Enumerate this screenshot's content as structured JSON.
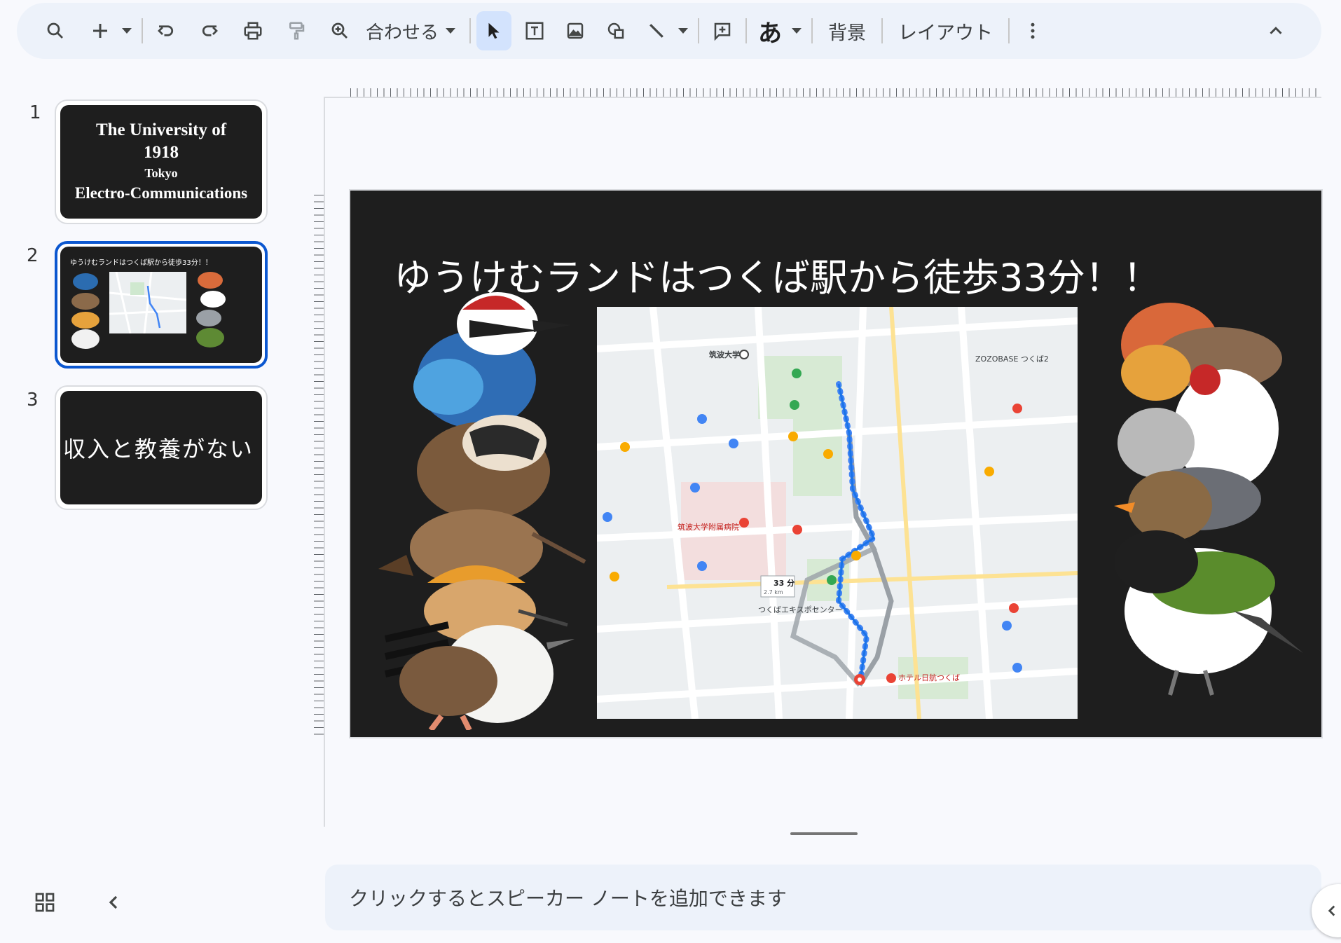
{
  "toolbar": {
    "fit_label": "合わせる",
    "font_glyph": "あ",
    "background_label": "背景",
    "layout_label": "レイアウト"
  },
  "slides": [
    {
      "number": "1",
      "lines": [
        "The University of",
        "1918",
        "Tokyo",
        "Electro-Communications"
      ]
    },
    {
      "number": "2",
      "title": "ゆうけむランドはつくば駅から徒歩33分！！"
    },
    {
      "number": "3",
      "text": "収入と教養がない"
    }
  ],
  "current_slide": {
    "title": "ゆうけむランドはつくば駅から徒歩33分！！",
    "map_labels": {
      "university": "筑波大学",
      "route_time": "33 分",
      "route_distance": "2.7 km",
      "hospital": "筑波大学附属病院",
      "zozobase": "ZOZOBASE つくば2",
      "hotel": "ホテル日航つくば",
      "center": "つくばエキスポセンター"
    }
  },
  "notes": {
    "placeholder": "クリックするとスピーカー ノートを追加できます"
  },
  "colors": {
    "accent": "#0b57d0",
    "toolbar_bg": "#edf2fa",
    "slide_bg": "#1e1e1e",
    "route": "#4285f4"
  }
}
